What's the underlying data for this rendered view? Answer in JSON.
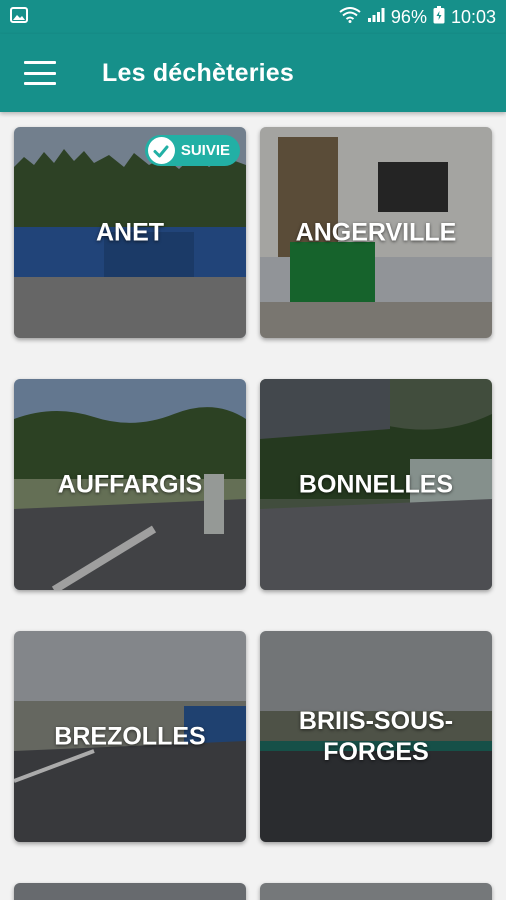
{
  "status": {
    "battery": "96%",
    "time": "10:03"
  },
  "appbar": {
    "title": "Les déchèteries"
  },
  "cards": [
    {
      "name": "ANET",
      "badge": "SUIVIE"
    },
    {
      "name": "ANGERVILLE"
    },
    {
      "name": "AUFFARGIS"
    },
    {
      "name": "BONNELLES"
    },
    {
      "name": "BREZOLLES"
    },
    {
      "name": "BRIIS-SOUS-FORGES"
    }
  ],
  "colors": {
    "primary": "#16908a",
    "badge": "#22b0a5"
  }
}
